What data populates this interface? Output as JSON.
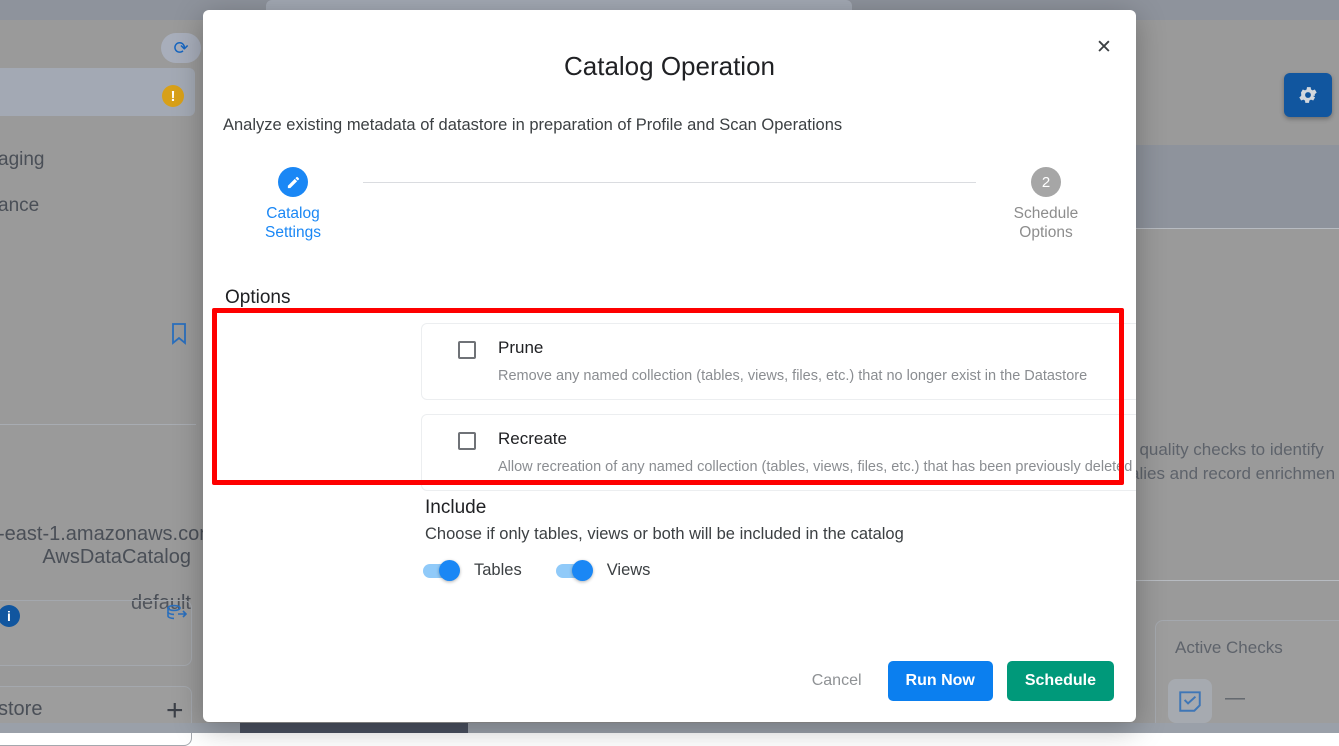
{
  "background": {
    "refresh_icon": "refresh-icon",
    "warning_icon": "warning-icon",
    "gear_icon": "gear-icon",
    "bookmark_icon": "bookmark-icon",
    "info_icon": "info-icon",
    "database_export_icon": "database-export-icon",
    "plus_icon": "plus-icon",
    "check_tile_icon": "checklist-icon",
    "texts": {
      "staging": "aging",
      "finance": "ance",
      "host": "-east-1.amazonaws.com",
      "catalog": "AwsDataCatalog",
      "database": "default",
      "datastore": "store",
      "quality_line1": "t quality checks to identify",
      "quality_line2": "alies and record enrichmen",
      "active_checks_label": "Active Checks",
      "active_checks_value": "—"
    }
  },
  "modal": {
    "title": "Catalog Operation",
    "subtitle": "Analyze existing metadata of datastore in preparation of Profile and Scan Operations",
    "close_icon": "close-icon",
    "stepper": {
      "steps": [
        {
          "badge": "pencil-icon",
          "line1": "Catalog",
          "line2": "Settings",
          "state": "active"
        },
        {
          "badge": "2",
          "line1": "Schedule",
          "line2": "Options",
          "state": "inactive"
        }
      ]
    },
    "options": {
      "heading": "Options",
      "items": [
        {
          "title": "Prune",
          "description": "Remove any named collection (tables, views, files, etc.) that no longer exist in the Datastore",
          "checked": false
        },
        {
          "title": "Recreate",
          "description": "Allow recreation of any named collection (tables, views, files, etc.) that has been previously deleted in Qualytics",
          "checked": false
        }
      ]
    },
    "include": {
      "heading": "Include",
      "description": "Choose if only tables, views or both will be included in the catalog",
      "toggles": [
        {
          "label": "Tables",
          "on": true
        },
        {
          "label": "Views",
          "on": true
        }
      ]
    },
    "footer": {
      "cancel_label": "Cancel",
      "run_now_label": "Run Now",
      "schedule_label": "Schedule"
    }
  },
  "colors": {
    "accent_blue": "#1a87f5",
    "run_now_blue": "#0b7fef",
    "schedule_teal": "#00997a",
    "highlight_red": "#fe0000",
    "inactive_gray": "#a6a6a6"
  }
}
